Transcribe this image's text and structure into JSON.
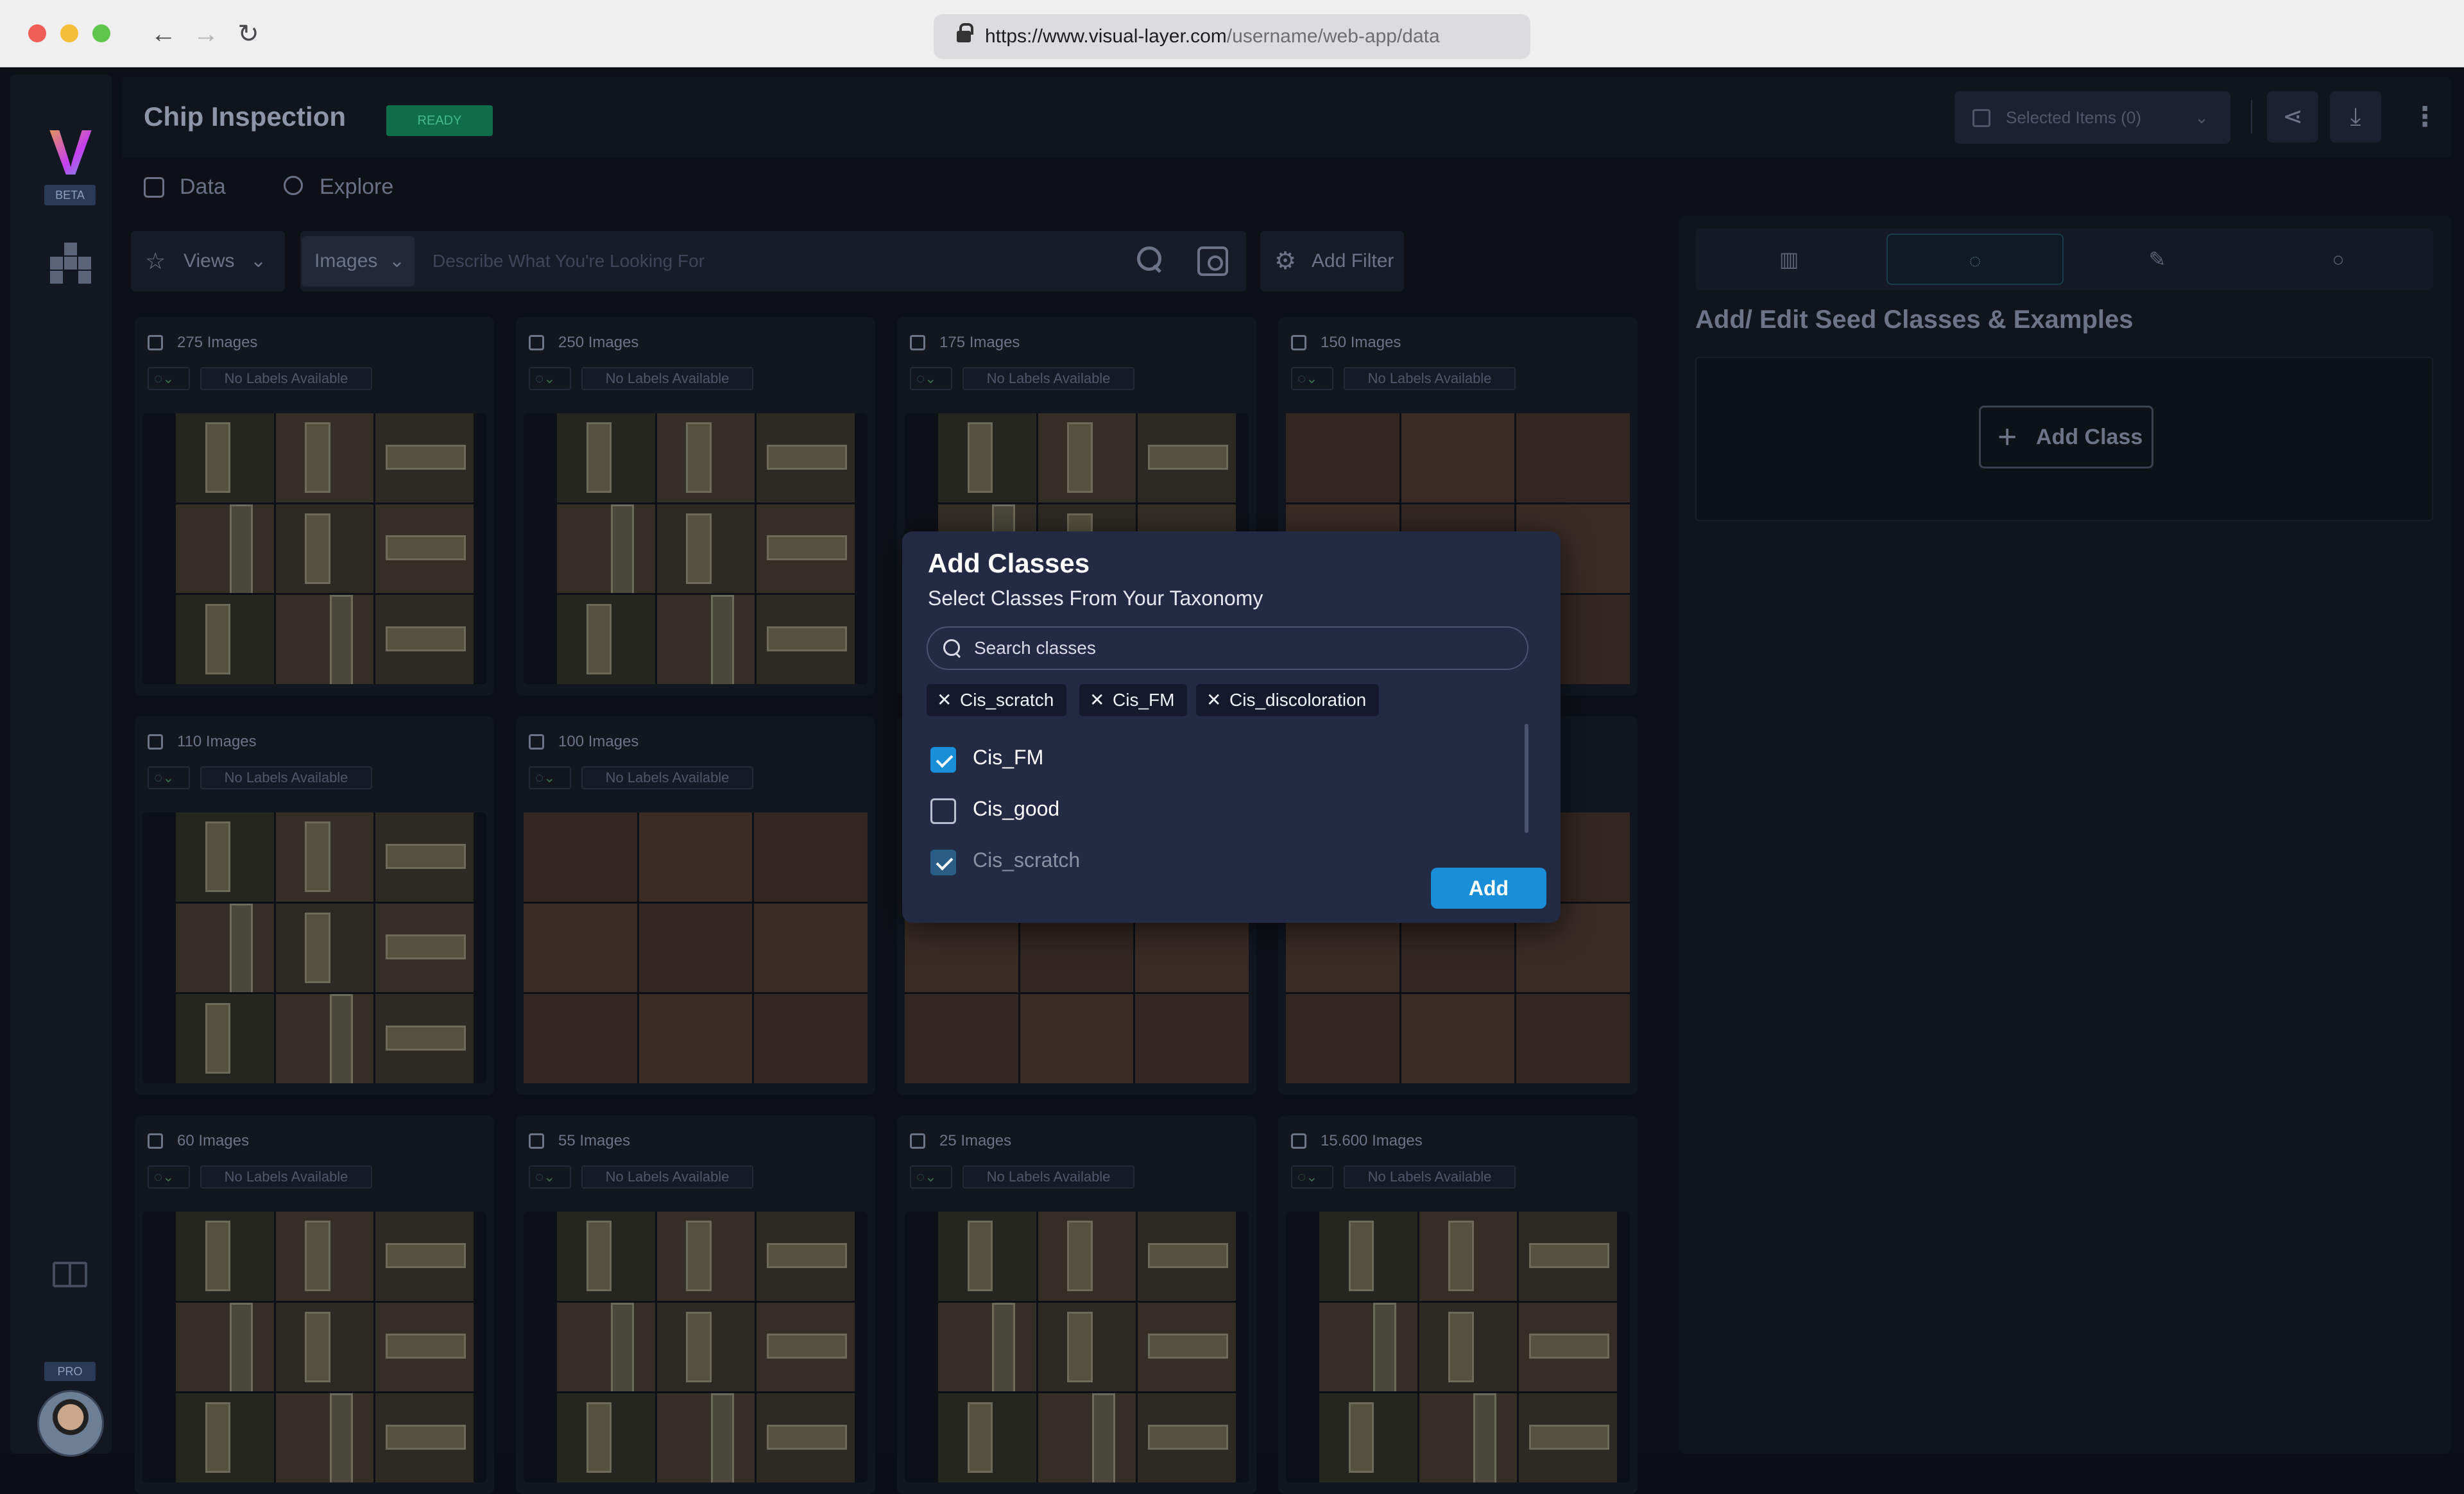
{
  "browser": {
    "url_host": "https://www.visual-layer.com",
    "url_path": "/username/web-app/data",
    "nav": {
      "back": "←",
      "forward": "→",
      "reload": "↻"
    }
  },
  "sidebar": {
    "logo": "V",
    "beta_badge": "BETA",
    "pro_badge": "PRO"
  },
  "header": {
    "title": "Chip Inspection",
    "status_badge": "READY",
    "selected_items": "Selected Items (0)",
    "more": "⋮"
  },
  "tabs": [
    {
      "label": "Data"
    },
    {
      "label": "Explore"
    }
  ],
  "toolbar": {
    "views_label": "Views",
    "images_select": "Images",
    "search_placeholder": "Describe What You're Looking For",
    "add_filter": "Add Filter"
  },
  "cards": [
    {
      "count": "275 Images",
      "labels": "No Labels Available"
    },
    {
      "count": "250 Images",
      "labels": "No Labels Available"
    },
    {
      "count": "175 Images",
      "labels": "No Labels Available"
    },
    {
      "count": "150 Images",
      "labels": "No Labels Available"
    },
    {
      "count": "110 Images",
      "labels": "No Labels Available"
    },
    {
      "count": "100 Images",
      "labels": "No Labels Available"
    },
    {
      "count": "",
      "labels": ""
    },
    {
      "count": "",
      "labels": ""
    },
    {
      "count": "60 Images",
      "labels": "No Labels Available"
    },
    {
      "count": "55 Images",
      "labels": "No Labels Available"
    },
    {
      "count": "25 Images",
      "labels": "No Labels Available"
    },
    {
      "count": "15.600 Images",
      "labels": "No Labels Available"
    }
  ],
  "panel": {
    "title": "Add/ Edit Seed Classes & Examples",
    "add_class": "Add Class",
    "tab_icons": [
      "chart-icon",
      "tag-icon",
      "magic-wand-icon",
      "chat-icon"
    ]
  },
  "modal": {
    "title": "Add Classes",
    "subtitle": "Select Classes From Your Taxonomy",
    "search_placeholder": "Search classes",
    "chips": [
      "Cis_scratch",
      "Cis_FM",
      "Cis_discoloration"
    ],
    "options": [
      {
        "label": "Cis_FM",
        "checked": true
      },
      {
        "label": "Cis_good",
        "checked": false
      },
      {
        "label": "Cis_scratch",
        "checked": true
      }
    ],
    "add_button": "Add"
  },
  "colors": {
    "accent": "#1a8fd9",
    "ready": "#0f6d4b",
    "modal_bg": "#232a44"
  }
}
